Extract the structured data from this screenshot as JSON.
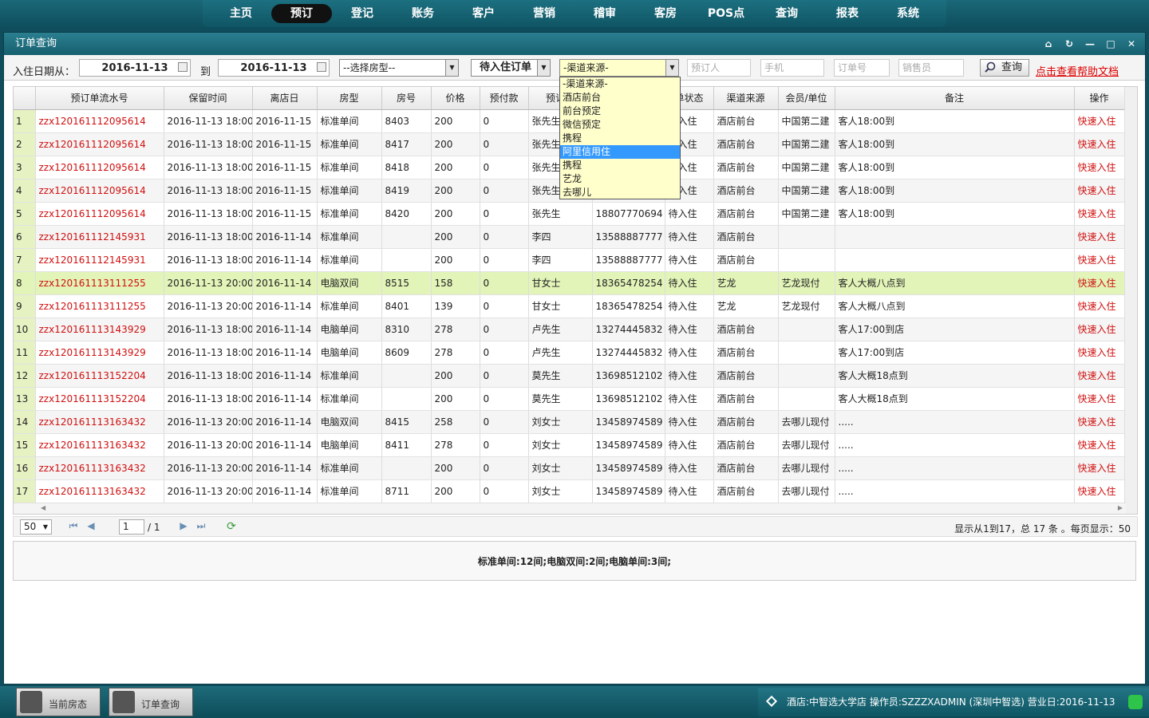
{
  "nav": [
    "主页",
    "预订",
    "登记",
    "账务",
    "客户",
    "营销",
    "稽审",
    "客房",
    "POS点",
    "查询",
    "报表",
    "系统"
  ],
  "nav_active": 1,
  "window_title": "订单查询",
  "filter": {
    "date_from_label": "入住日期从：",
    "date_from": "2016-11-13",
    "to_label": "到",
    "date_to": "2016-11-13",
    "room_type": "--选择房型--",
    "order_status": "待入住订单",
    "channel": "-渠道来源-",
    "booker_placeholder": "预订人",
    "phone_placeholder": "手机",
    "order_no_placeholder": "订单号",
    "sales_placeholder": "销售员",
    "search_label": "查询",
    "help_link": "点击查看帮助文档"
  },
  "channel_options": [
    "-渠道来源-",
    "酒店前台",
    "前台预定",
    "微信预定",
    "携程",
    "阿里信用住",
    "携程",
    "艺龙",
    "去哪儿"
  ],
  "channel_selected_index": 5,
  "columns": [
    "",
    "预订单流水号",
    "保留时间",
    "离店日",
    "房型",
    "房号",
    "价格",
    "预付款",
    "预订人",
    "手机",
    "单状态",
    "渠道来源",
    "会员/单位",
    "备注",
    "操作"
  ],
  "rows": [
    [
      "1",
      "zzx120161112095614",
      "2016-11-13 18:00",
      "2016-11-15",
      "标准单间",
      "8403",
      "200",
      "0",
      "张先生",
      "18807770694",
      "待入住",
      "酒店前台",
      "中国第二建",
      "客人18:00到",
      "快速入住"
    ],
    [
      "2",
      "zzx120161112095614",
      "2016-11-13 18:00",
      "2016-11-15",
      "标准单间",
      "8417",
      "200",
      "0",
      "张先生",
      "18807770694",
      "待入住",
      "酒店前台",
      "中国第二建",
      "客人18:00到",
      "快速入住"
    ],
    [
      "3",
      "zzx120161112095614",
      "2016-11-13 18:00",
      "2016-11-15",
      "标准单间",
      "8418",
      "200",
      "0",
      "张先生",
      "18807770694",
      "待入住",
      "酒店前台",
      "中国第二建",
      "客人18:00到",
      "快速入住"
    ],
    [
      "4",
      "zzx120161112095614",
      "2016-11-13 18:00",
      "2016-11-15",
      "标准单间",
      "8419",
      "200",
      "0",
      "张先生",
      "18807770694",
      "待入住",
      "酒店前台",
      "中国第二建",
      "客人18:00到",
      "快速入住"
    ],
    [
      "5",
      "zzx120161112095614",
      "2016-11-13 18:00",
      "2016-11-15",
      "标准单间",
      "8420",
      "200",
      "0",
      "张先生",
      "18807770694",
      "待入住",
      "酒店前台",
      "中国第二建",
      "客人18:00到",
      "快速入住"
    ],
    [
      "6",
      "zzx120161112145931",
      "2016-11-13 18:00",
      "2016-11-14",
      "标准单间",
      "",
      "200",
      "0",
      "李四",
      "13588887777",
      "待入住",
      "酒店前台",
      "",
      "",
      "快速入住"
    ],
    [
      "7",
      "zzx120161112145931",
      "2016-11-13 18:00",
      "2016-11-14",
      "标准单间",
      "",
      "200",
      "0",
      "李四",
      "13588887777",
      "待入住",
      "酒店前台",
      "",
      "",
      "快速入住"
    ],
    [
      "8",
      "zzx120161113111255",
      "2016-11-13 20:00",
      "2016-11-14",
      "电脑双间",
      "8515",
      "158",
      "0",
      "甘女士",
      "18365478254",
      "待入住",
      "艺龙",
      "艺龙现付",
      "客人大概八点到",
      "快速入住"
    ],
    [
      "9",
      "zzx120161113111255",
      "2016-11-13 20:00",
      "2016-11-14",
      "标准单间",
      "8401",
      "139",
      "0",
      "甘女士",
      "18365478254",
      "待入住",
      "艺龙",
      "艺龙现付",
      "客人大概八点到",
      "快速入住"
    ],
    [
      "10",
      "zzx120161113143929",
      "2016-11-13 18:00",
      "2016-11-14",
      "电脑单间",
      "8310",
      "278",
      "0",
      "卢先生",
      "13274445832",
      "待入住",
      "酒店前台",
      "",
      "客人17:00到店",
      "快速入住"
    ],
    [
      "11",
      "zzx120161113143929",
      "2016-11-13 18:00",
      "2016-11-14",
      "电脑单间",
      "8609",
      "278",
      "0",
      "卢先生",
      "13274445832",
      "待入住",
      "酒店前台",
      "",
      "客人17:00到店",
      "快速入住"
    ],
    [
      "12",
      "zzx120161113152204",
      "2016-11-13 18:00",
      "2016-11-14",
      "标准单间",
      "",
      "200",
      "0",
      "莫先生",
      "13698512102",
      "待入住",
      "酒店前台",
      "",
      "客人大概18点到",
      "快速入住"
    ],
    [
      "13",
      "zzx120161113152204",
      "2016-11-13 18:00",
      "2016-11-14",
      "标准单间",
      "",
      "200",
      "0",
      "莫先生",
      "13698512102",
      "待入住",
      "酒店前台",
      "",
      "客人大概18点到",
      "快速入住"
    ],
    [
      "14",
      "zzx120161113163432",
      "2016-11-13 20:00",
      "2016-11-14",
      "电脑双间",
      "8415",
      "258",
      "0",
      "刘女士",
      "13458974589",
      "待入住",
      "酒店前台",
      "去哪儿现付",
      ".....",
      "快速入住"
    ],
    [
      "15",
      "zzx120161113163432",
      "2016-11-13 20:00",
      "2016-11-14",
      "电脑单间",
      "8411",
      "278",
      "0",
      "刘女士",
      "13458974589",
      "待入住",
      "酒店前台",
      "去哪儿现付",
      ".....",
      "快速入住"
    ],
    [
      "16",
      "zzx120161113163432",
      "2016-11-13 20:00",
      "2016-11-14",
      "标准单间",
      "",
      "200",
      "0",
      "刘女士",
      "13458974589",
      "待入住",
      "酒店前台",
      "去哪儿现付",
      ".....",
      "快速入住"
    ],
    [
      "17",
      "zzx120161113163432",
      "2016-11-13 20:00",
      "2016-11-14",
      "标准单间",
      "8711",
      "200",
      "0",
      "刘女士",
      "13458974589",
      "待入住",
      "酒店前台",
      "去哪儿现付",
      ".....",
      "快速入住"
    ]
  ],
  "highlight_row": 7,
  "pager": {
    "page_size": "50",
    "page": "1",
    "total_pages": "/ 1",
    "info": "显示从1到17，总 17 条 。每页显示：50"
  },
  "summary": "标准单间:12间;电脑双间:2间;电脑单间:3间;",
  "taskbar": [
    "当前房态",
    "订单查询"
  ],
  "status": "酒店:中智选大学店   操作员:SZZZXADMIN (深圳中智选)   营业日:2016-11-13",
  "colors": {
    "accent": "#0f4c5c",
    "link": "#d01010",
    "dropdown_bg": "#ffffcc",
    "selected": "#3399ff"
  }
}
